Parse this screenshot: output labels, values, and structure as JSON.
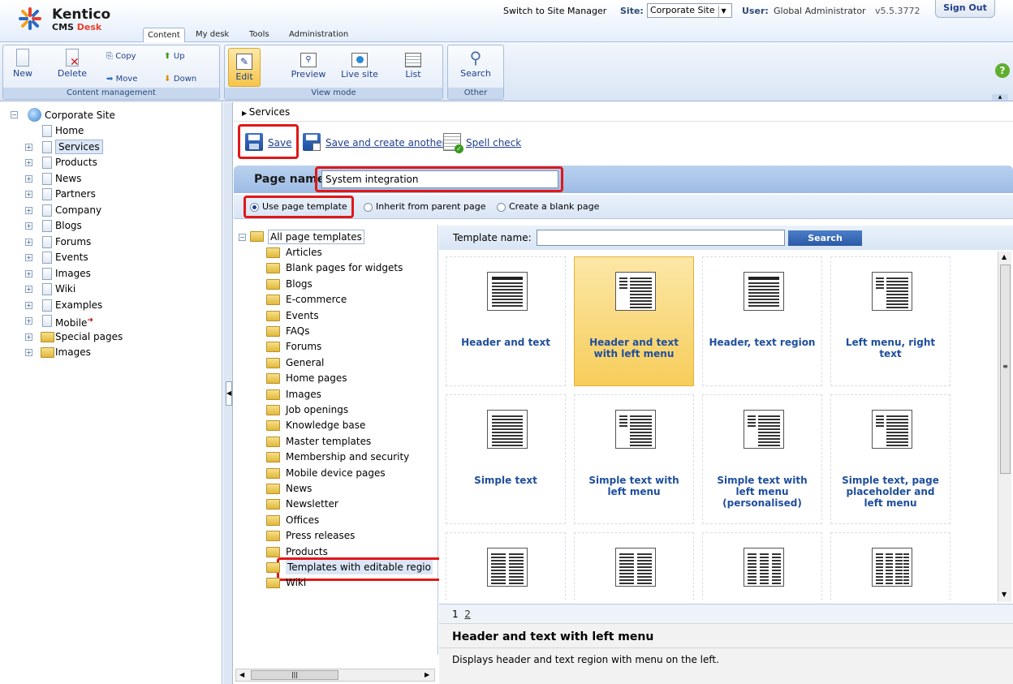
{
  "brand": {
    "name": "Kentico",
    "sub_prefix": "CMS ",
    "sub_accent": "Desk",
    "accent_color": "#e8412c"
  },
  "tabs": [
    "Content",
    "My desk",
    "Tools",
    "Administration"
  ],
  "header": {
    "switch_link": "Switch to Site Manager",
    "site_label": "Site:",
    "site_value": "Corporate Site",
    "user_label": "User:",
    "user_value": "Global Administrator",
    "version": "v5.5.3772",
    "signout": "Sign Out"
  },
  "ribbon": {
    "content_management": {
      "label": "Content management",
      "new": "New",
      "delete": "Delete",
      "copy": "Copy",
      "move": "Move",
      "up": "Up",
      "down": "Down"
    },
    "view_mode": {
      "label": "View mode",
      "edit": "Edit",
      "preview": "Preview",
      "live_site": "Live site",
      "list": "List"
    },
    "other": {
      "label": "Other",
      "search": "Search"
    }
  },
  "content_tree": {
    "root": "Corporate Site",
    "items": [
      "Home",
      "Services",
      "Products",
      "News",
      "Partners",
      "Company",
      "Blogs",
      "Forums",
      "Events",
      "Images",
      "Wiki",
      "Examples",
      "Mobile",
      "Special pages",
      "Images"
    ],
    "selected": "Services"
  },
  "breadcrumb": "Services",
  "actions": {
    "save": "Save",
    "save_another": "Save and create another",
    "spell_check": "Spell check"
  },
  "page_name": {
    "label": "Page name:",
    "value": "System integration"
  },
  "mode_options": {
    "use_template": "Use page template",
    "inherit": "Inherit from parent page",
    "blank": "Create a blank page",
    "selected": "Use page template"
  },
  "template_tree": {
    "root": "All page templates",
    "items": [
      "Articles",
      "Blank pages for widgets",
      "Blogs",
      "E-commerce",
      "Events",
      "FAQs",
      "Forums",
      "General",
      "Home pages",
      "Images",
      "Job openings",
      "Knowledge base",
      "Master templates",
      "Membership and security",
      "Mobile device pages",
      "News",
      "Newsletter",
      "Offices",
      "Press releases",
      "Products",
      "Templates with editable regio",
      "Wiki"
    ],
    "selected": "Templates with editable regio"
  },
  "template_search": {
    "label": "Template name:",
    "value": "",
    "button": "Search"
  },
  "templates": [
    {
      "title": "Header and text"
    },
    {
      "title": "Header and text with left menu",
      "selected": true
    },
    {
      "title": "Header, text region"
    },
    {
      "title": "Left menu, right text"
    },
    {
      "title": "Simple text"
    },
    {
      "title": "Simple text with left menu"
    },
    {
      "title": "Simple text with left menu (personalised)"
    },
    {
      "title": "Simple text, page placeholder and left menu"
    },
    {
      "title": ""
    },
    {
      "title": ""
    },
    {
      "title": ""
    },
    {
      "title": ""
    }
  ],
  "pager": {
    "page1": "1",
    "page2": "2"
  },
  "description": {
    "title": "Header and text with left menu",
    "text": "Displays header and text region with menu on the left."
  }
}
